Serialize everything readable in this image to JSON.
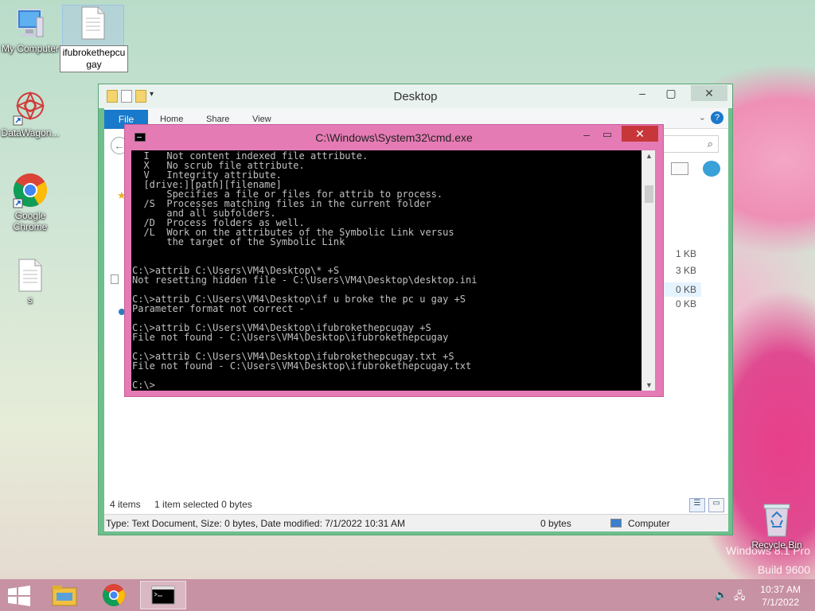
{
  "desktop": {
    "icons": [
      {
        "label": "My Computer"
      },
      {
        "label": "ifubrokethepcugay"
      },
      {
        "label": "DataWagon..."
      },
      {
        "label": "Google Chrome"
      },
      {
        "label": "s"
      },
      {
        "label": "Recycle Bin"
      }
    ],
    "watermark": {
      "line1": "Windows 8.1 Pro",
      "line2": "Build 9600"
    }
  },
  "explorer": {
    "title": "Desktop",
    "ribbon_tabs": [
      "File",
      "Home",
      "Share",
      "View"
    ],
    "sizes": [
      "1 KB",
      "3 KB",
      "0 KB",
      "0 KB"
    ],
    "status": {
      "items": "4 items",
      "selected": "1 item selected  0 bytes"
    },
    "details_bar": {
      "info": "Type: Text Document, Size: 0 bytes, Date modified: 7/1/2022 10:31 AM",
      "size": "0 bytes",
      "location": "Computer"
    }
  },
  "cmd": {
    "title": "C:\\Windows\\System32\\cmd.exe",
    "output": "  I   Not content indexed file attribute.\n  X   No scrub file attribute.\n  V   Integrity attribute.\n  [drive:][path][filename]\n      Specifies a file or files for attrib to process.\n  /S  Processes matching files in the current folder\n      and all subfolders.\n  /D  Process folders as well.\n  /L  Work on the attributes of the Symbolic Link versus\n      the target of the Symbolic Link\n\n\nC:\\>attrib C:\\Users\\VM4\\Desktop\\* +S\nNot resetting hidden file - C:\\Users\\VM4\\Desktop\\desktop.ini\n\nC:\\>attrib C:\\Users\\VM4\\Desktop\\if u broke the pc u gay +S\nParameter format not correct -\n\nC:\\>attrib C:\\Users\\VM4\\Desktop\\ifubrokethepcugay +S\nFile not found - C:\\Users\\VM4\\Desktop\\ifubrokethepcugay\n\nC:\\>attrib C:\\Users\\VM4\\Desktop\\ifubrokethepcugay.txt +S\nFile not found - C:\\Users\\VM4\\Desktop\\ifubrokethepcugay.txt\n\nC:\\>"
  },
  "taskbar": {
    "clock_time": "10:37 AM",
    "clock_date": "7/1/2022"
  },
  "colors": {
    "cmd_frame": "#e57bb4",
    "cmd_close": "#c7373a",
    "file_tab": "#1979ca",
    "taskbar": "#c48ca0"
  },
  "icons": [
    "computer-icon",
    "text-file-icon",
    "datawagon-icon",
    "chrome-icon",
    "recycle-bin-icon",
    "windows-start-icon",
    "file-explorer-icon",
    "cmd-icon",
    "volume-muted-icon",
    "network-icon",
    "search-icon",
    "help-icon"
  ]
}
